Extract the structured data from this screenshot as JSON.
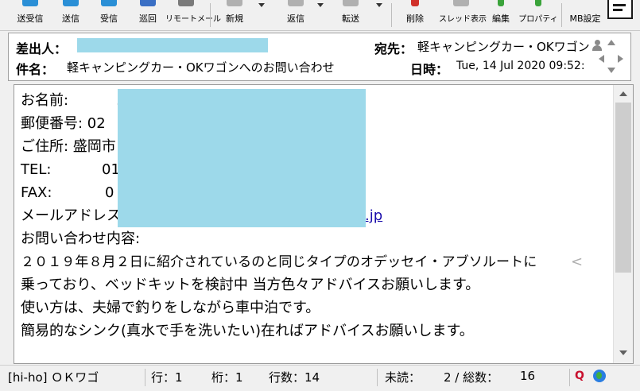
{
  "toolbar": {
    "send_receive": "送受信",
    "send": "送信",
    "receive": "受信",
    "patrol": "巡回",
    "remote_mail": "リモートメール",
    "new": "新規",
    "reply": "返信",
    "forward": "転送",
    "delete": "削除",
    "thread_view": "スレッド表示",
    "edit": "編集",
    "properties": "プロパティ",
    "mb_settings": "MB設定"
  },
  "header": {
    "from_label": "差出人：",
    "subject_label": "件名：",
    "subject": "軽キャンピングカー・OKワゴンへのお問い合わせ",
    "to_label": "宛先：",
    "to": "軽キャンピングカー・OKワゴン",
    "date_label": "日時：",
    "date": "Tue, 14 Jul 2020 09:52:"
  },
  "message": {
    "name_label": "お名前:",
    "name_frag": ".",
    "zip_label": "郵便番号: 02",
    "address_label": "ご住所: 盛岡市",
    "tel_label": "TEL:",
    "tel_frag": "01",
    "fax_label": "FAX:",
    "fax_frag": "0",
    "email_label": "メールアドレス:",
    "email_link": ".jp",
    "inquiry_label": "お問い合わせ内容:",
    "body_lines": [
      "２０１９年８月２日に紹介されているのと同じタイプのオデッセイ・アブソルートに",
      "乗っており、ベッドキットを検討中 当方色々アドバイスお願いします。",
      "使い方は、夫婦で釣りをしながら車中泊です。",
      "簡易的なシンク(真水で手を洗いたい)在ればアドバイスお願いします。"
    ],
    "wrap_mark": "<"
  },
  "status": {
    "account": "[hi-ho] ＯＫワゴ",
    "row": "行：1",
    "col": "桁：1",
    "lines": "行数：14",
    "unread": "未読：",
    "unread_total": "2 / 総数：",
    "total": "16"
  },
  "colors": {
    "redaction": "#9dd9ea",
    "link": "#1a0dab"
  }
}
